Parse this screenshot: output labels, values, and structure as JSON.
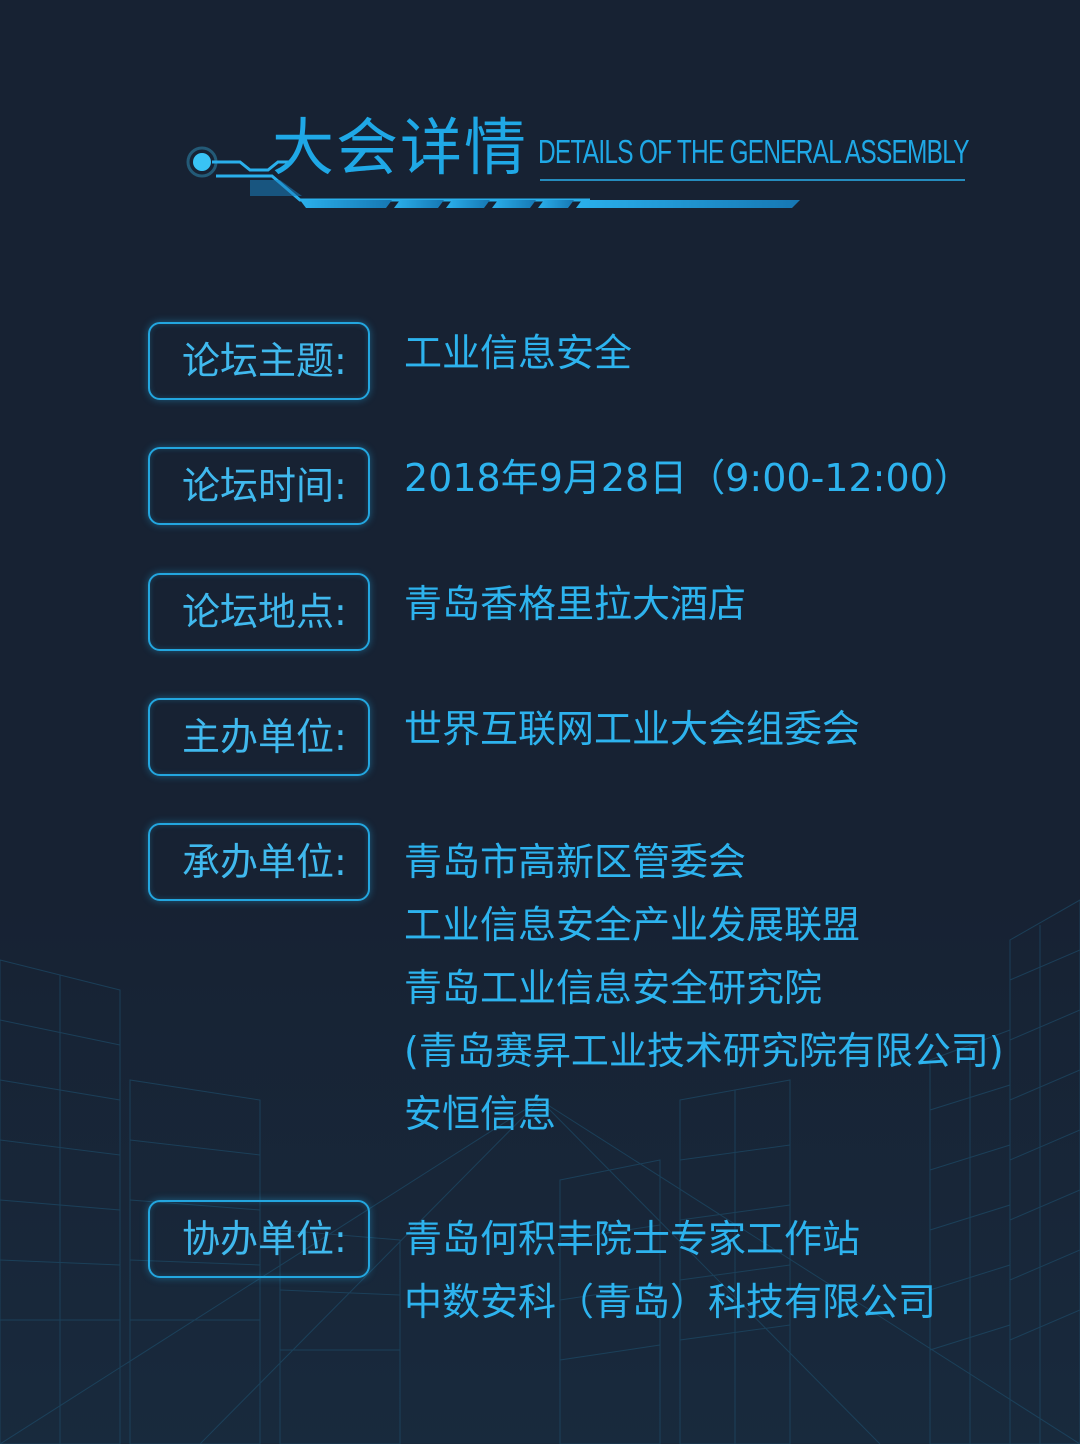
{
  "header": {
    "title_cn": "大会详情",
    "title_en": "DETAILS OF THE GENERAL ASSEMBLY"
  },
  "rows": [
    {
      "label": "论坛主题:",
      "values": [
        "工业信息安全"
      ]
    },
    {
      "label": "论坛时间:",
      "values": [
        "2018年9月28日（9:00-12:00）"
      ]
    },
    {
      "label": "论坛地点:",
      "values": [
        "青岛香格里拉大酒店"
      ]
    },
    {
      "label": "主办单位:",
      "values": [
        "世界互联网工业大会组委会"
      ]
    },
    {
      "label": "承办单位:",
      "values": [
        "青岛市高新区管委会",
        "工业信息安全产业发展联盟",
        "青岛工业信息安全研究院",
        "(青岛赛昇工业技术研究院有限公司)",
        "安恒信息"
      ]
    },
    {
      "label": "协办单位:",
      "values": [
        "青岛何积丰院士专家工作站",
        "中数安科（青岛）科技有限公司"
      ]
    }
  ],
  "colors": {
    "background": "#172233",
    "accent": "#23a6df",
    "text": "#2db3ee"
  }
}
